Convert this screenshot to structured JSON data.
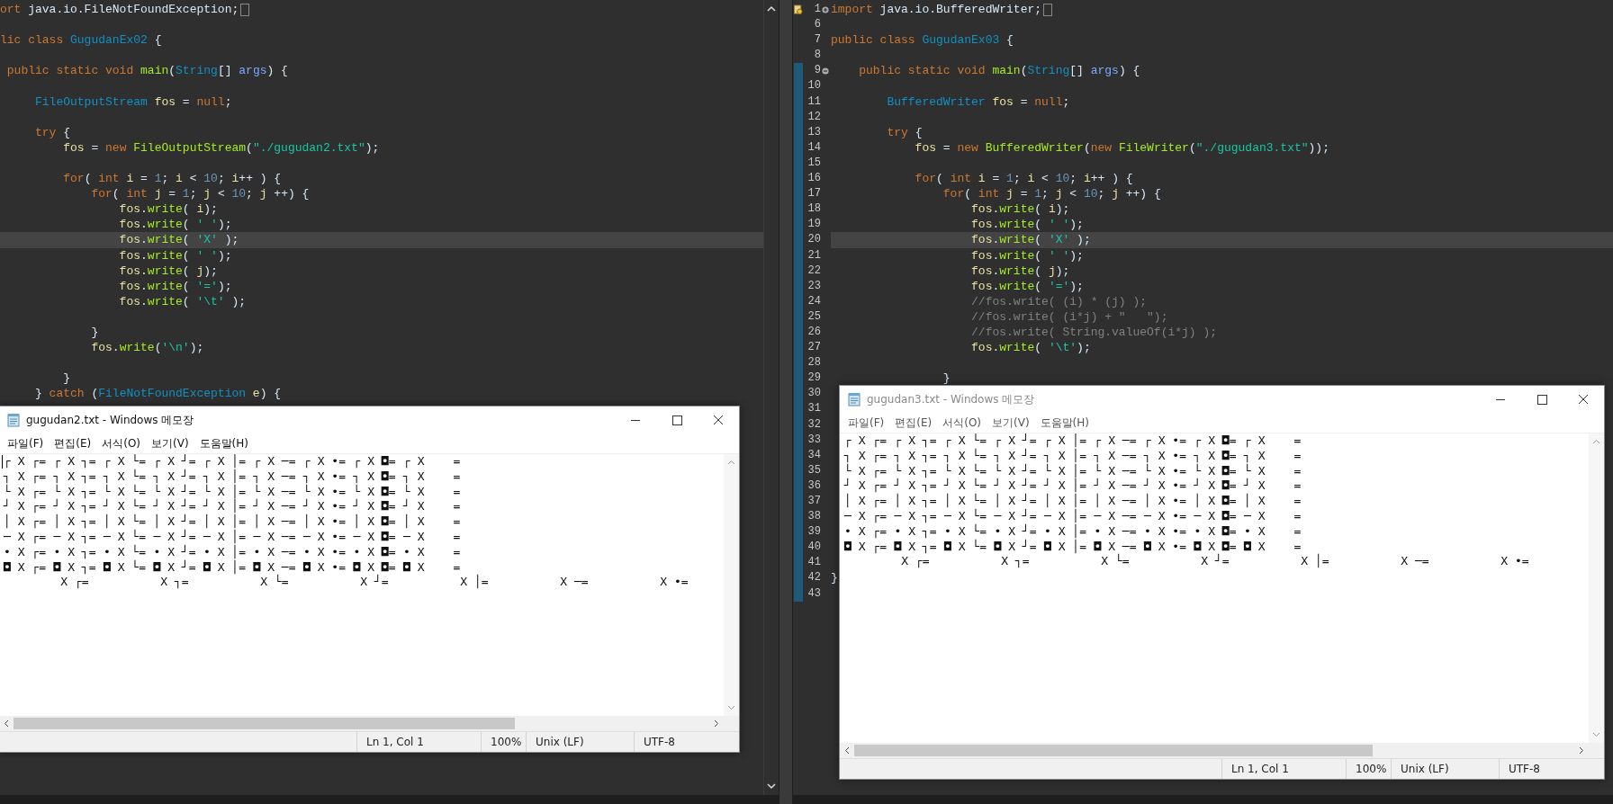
{
  "editors": [
    {
      "lines": [
        {
          "current": false,
          "folded": true,
          "tokens": [
            {
              "text": "ort",
              "kind": "keyword"
            },
            {
              "text": " java.io.FileNotFoundException;"
            }
          ]
        },
        {
          "current": false
        },
        {
          "current": false,
          "tokens": [
            {
              "text": "lic",
              "kind": "keyword"
            },
            {
              "text": " class",
              "kind": "keyword"
            },
            {
              "text": " GugudanEx02",
              "kind": "type"
            },
            {
              "text": " {"
            }
          ]
        },
        {
          "current": false
        },
        {
          "current": false,
          "tokens": [
            {
              "text": " public static void",
              "kind": "keyword"
            },
            {
              "text": " main",
              "kind": "method"
            },
            {
              "text": "("
            },
            {
              "text": "String",
              "kind": "type"
            },
            {
              "text": "[] "
            },
            {
              "text": "args",
              "kind": "param"
            },
            {
              "text": ") {"
            }
          ]
        },
        {
          "current": false
        },
        {
          "current": false,
          "tokens": [
            {
              "text": "     FileOutputStream",
              "kind": "type"
            },
            {
              "text": " fos",
              "kind": "variable"
            },
            {
              "text": " = "
            },
            {
              "text": "null",
              "kind": "keyword"
            },
            {
              "text": ";"
            }
          ]
        },
        {
          "current": false
        },
        {
          "current": false,
          "tokens": [
            {
              "text": "     try",
              "kind": "keyword"
            },
            {
              "text": " {"
            }
          ]
        },
        {
          "current": false,
          "tokens": [
            {
              "text": "         fos",
              "kind": "variable"
            },
            {
              "text": " = "
            },
            {
              "text": "new",
              "kind": "keyword"
            },
            {
              "text": " FileOutputStream",
              "kind": "method"
            },
            {
              "text": "("
            },
            {
              "text": "\"./gugudan2.txt\"",
              "kind": "string"
            },
            {
              "text": ");"
            }
          ]
        },
        {
          "current": false
        },
        {
          "current": false,
          "tokens": [
            {
              "text": "         for",
              "kind": "keyword"
            },
            {
              "text": "( "
            },
            {
              "text": "int",
              "kind": "keyword"
            },
            {
              "text": " i",
              "kind": "variable"
            },
            {
              "text": " = "
            },
            {
              "text": "1",
              "kind": "number"
            },
            {
              "text": "; "
            },
            {
              "text": "i",
              "kind": "variable"
            },
            {
              "text": " < "
            },
            {
              "text": "10",
              "kind": "number"
            },
            {
              "text": "; "
            },
            {
              "text": "i",
              "kind": "variable"
            },
            {
              "text": "++ ) {"
            }
          ]
        },
        {
          "current": false,
          "tokens": [
            {
              "text": "             for",
              "kind": "keyword"
            },
            {
              "text": "( "
            },
            {
              "text": "int",
              "kind": "keyword"
            },
            {
              "text": " j",
              "kind": "variable"
            },
            {
              "text": " = "
            },
            {
              "text": "1",
              "kind": "number"
            },
            {
              "text": "; "
            },
            {
              "text": "j",
              "kind": "variable"
            },
            {
              "text": " < "
            },
            {
              "text": "10",
              "kind": "number"
            },
            {
              "text": "; "
            },
            {
              "text": "j",
              "kind": "variable"
            },
            {
              "text": " ++) {"
            }
          ]
        },
        {
          "current": false,
          "tokens": [
            {
              "text": "                 fos",
              "kind": "variable"
            },
            {
              "text": "."
            },
            {
              "text": "write",
              "kind": "method"
            },
            {
              "text": "( "
            },
            {
              "text": "i",
              "kind": "variable"
            },
            {
              "text": ");"
            }
          ]
        },
        {
          "current": false,
          "tokens": [
            {
              "text": "                 fos",
              "kind": "variable"
            },
            {
              "text": "."
            },
            {
              "text": "write",
              "kind": "method"
            },
            {
              "text": "( "
            },
            {
              "text": "' '",
              "kind": "string"
            },
            {
              "text": ");"
            }
          ]
        },
        {
          "current": true,
          "tokens": [
            {
              "text": "                 fos",
              "kind": "variable"
            },
            {
              "text": "."
            },
            {
              "text": "write",
              "kind": "method"
            },
            {
              "text": "( "
            },
            {
              "text": "'X'",
              "kind": "string"
            },
            {
              "text": " );"
            }
          ]
        },
        {
          "current": false,
          "tokens": [
            {
              "text": "                 fos",
              "kind": "variable"
            },
            {
              "text": "."
            },
            {
              "text": "write",
              "kind": "method"
            },
            {
              "text": "( "
            },
            {
              "text": "' '",
              "kind": "string"
            },
            {
              "text": ");"
            }
          ]
        },
        {
          "current": false,
          "tokens": [
            {
              "text": "                 fos",
              "kind": "variable"
            },
            {
              "text": "."
            },
            {
              "text": "write",
              "kind": "method"
            },
            {
              "text": "( "
            },
            {
              "text": "j",
              "kind": "variable"
            },
            {
              "text": ");"
            }
          ]
        },
        {
          "current": false,
          "tokens": [
            {
              "text": "                 fos",
              "kind": "variable"
            },
            {
              "text": "."
            },
            {
              "text": "write",
              "kind": "method"
            },
            {
              "text": "( "
            },
            {
              "text": "'='",
              "kind": "string"
            },
            {
              "text": ");"
            }
          ]
        },
        {
          "current": false,
          "tokens": [
            {
              "text": "                 fos",
              "kind": "variable"
            },
            {
              "text": "."
            },
            {
              "text": "write",
              "kind": "method"
            },
            {
              "text": "( "
            },
            {
              "text": "'\\t'",
              "kind": "string"
            },
            {
              "text": " );"
            }
          ]
        },
        {
          "current": false
        },
        {
          "current": false,
          "tokens": [
            {
              "text": "             }"
            }
          ]
        },
        {
          "current": false,
          "tokens": [
            {
              "text": "             fos",
              "kind": "variable"
            },
            {
              "text": "."
            },
            {
              "text": "write",
              "kind": "method"
            },
            {
              "text": "("
            },
            {
              "text": "'\\n'",
              "kind": "string"
            },
            {
              "text": ");"
            }
          ]
        },
        {
          "current": false
        },
        {
          "current": false,
          "tokens": [
            {
              "text": "         }"
            }
          ]
        },
        {
          "current": false,
          "tokens": [
            {
              "text": "     } "
            },
            {
              "text": "catch",
              "kind": "keyword"
            },
            {
              "text": " ("
            },
            {
              "text": "FileNotFoundException",
              "kind": "type"
            },
            {
              "text": " e",
              "kind": "variable"
            },
            {
              "text": ") {"
            }
          ]
        }
      ]
    },
    {
      "lines": [
        {
          "number": "1",
          "current": false,
          "changed": false,
          "annotation": true,
          "folded": true,
          "tokens": [
            {
              "text": "import",
              "kind": "keyword"
            },
            {
              "text": " java.io.BufferedWriter;"
            }
          ]
        },
        {
          "number": "6",
          "current": false,
          "changed": false
        },
        {
          "number": "7",
          "current": false,
          "changed": false,
          "tokens": [
            {
              "text": "public class",
              "kind": "keyword"
            },
            {
              "text": " GugudanEx03",
              "kind": "type"
            },
            {
              "text": " {"
            }
          ]
        },
        {
          "number": "8",
          "current": false,
          "changed": false
        },
        {
          "number": "9",
          "current": false,
          "changed": true,
          "folded": false,
          "tokens": [
            {
              "text": "    public static void",
              "kind": "keyword"
            },
            {
              "text": " main",
              "kind": "method"
            },
            {
              "text": "("
            },
            {
              "text": "String",
              "kind": "type"
            },
            {
              "text": "[] "
            },
            {
              "text": "args",
              "kind": "param"
            },
            {
              "text": ") {"
            }
          ]
        },
        {
          "number": "10",
          "current": false,
          "changed": true
        },
        {
          "number": "11",
          "current": false,
          "changed": true,
          "tokens": [
            {
              "text": "        BufferedWriter",
              "kind": "type"
            },
            {
              "text": " fos",
              "kind": "variable"
            },
            {
              "text": " = "
            },
            {
              "text": "null",
              "kind": "keyword"
            },
            {
              "text": ";"
            }
          ]
        },
        {
          "number": "12",
          "current": false,
          "changed": true
        },
        {
          "number": "13",
          "current": false,
          "changed": true,
          "tokens": [
            {
              "text": "        try",
              "kind": "keyword"
            },
            {
              "text": " {"
            }
          ]
        },
        {
          "number": "14",
          "current": false,
          "changed": true,
          "tokens": [
            {
              "text": "            fos",
              "kind": "variable"
            },
            {
              "text": " = "
            },
            {
              "text": "new",
              "kind": "keyword"
            },
            {
              "text": " BufferedWriter",
              "kind": "method"
            },
            {
              "text": "("
            },
            {
              "text": "new",
              "kind": "keyword"
            },
            {
              "text": " FileWriter",
              "kind": "method"
            },
            {
              "text": "("
            },
            {
              "text": "\"./gugudan3.txt\"",
              "kind": "string"
            },
            {
              "text": "));"
            }
          ]
        },
        {
          "number": "15",
          "current": false,
          "changed": true
        },
        {
          "number": "16",
          "current": false,
          "changed": true,
          "tokens": [
            {
              "text": "            for",
              "kind": "keyword"
            },
            {
              "text": "( "
            },
            {
              "text": "int",
              "kind": "keyword"
            },
            {
              "text": " i",
              "kind": "variable"
            },
            {
              "text": " = "
            },
            {
              "text": "1",
              "kind": "number"
            },
            {
              "text": "; "
            },
            {
              "text": "i",
              "kind": "variable"
            },
            {
              "text": " < "
            },
            {
              "text": "10",
              "kind": "number"
            },
            {
              "text": "; "
            },
            {
              "text": "i",
              "kind": "variable"
            },
            {
              "text": "++ ) {"
            }
          ]
        },
        {
          "number": "17",
          "current": false,
          "changed": true,
          "tokens": [
            {
              "text": "                for",
              "kind": "keyword"
            },
            {
              "text": "( "
            },
            {
              "text": "int",
              "kind": "keyword"
            },
            {
              "text": " j",
              "kind": "variable"
            },
            {
              "text": " = "
            },
            {
              "text": "1",
              "kind": "number"
            },
            {
              "text": "; "
            },
            {
              "text": "j",
              "kind": "variable"
            },
            {
              "text": " < "
            },
            {
              "text": "10",
              "kind": "number"
            },
            {
              "text": "; "
            },
            {
              "text": "j",
              "kind": "variable"
            },
            {
              "text": " ++) {"
            }
          ]
        },
        {
          "number": "18",
          "current": false,
          "changed": true,
          "tokens": [
            {
              "text": "                    fos",
              "kind": "variable"
            },
            {
              "text": "."
            },
            {
              "text": "write",
              "kind": "method"
            },
            {
              "text": "( "
            },
            {
              "text": "i",
              "kind": "variable"
            },
            {
              "text": ");"
            }
          ]
        },
        {
          "number": "19",
          "current": false,
          "changed": true,
          "tokens": [
            {
              "text": "                    fos",
              "kind": "variable"
            },
            {
              "text": "."
            },
            {
              "text": "write",
              "kind": "method"
            },
            {
              "text": "( "
            },
            {
              "text": "' '",
              "kind": "string"
            },
            {
              "text": ");"
            }
          ]
        },
        {
          "number": "20",
          "current": true,
          "changed": true,
          "tokens": [
            {
              "text": "                    fos",
              "kind": "variable"
            },
            {
              "text": "."
            },
            {
              "text": "write",
              "kind": "method"
            },
            {
              "text": "( "
            },
            {
              "text": "'X'",
              "kind": "string"
            },
            {
              "text": " );"
            }
          ]
        },
        {
          "number": "21",
          "current": false,
          "changed": true,
          "tokens": [
            {
              "text": "                    fos",
              "kind": "variable"
            },
            {
              "text": "."
            },
            {
              "text": "write",
              "kind": "method"
            },
            {
              "text": "( "
            },
            {
              "text": "' '",
              "kind": "string"
            },
            {
              "text": ");"
            }
          ]
        },
        {
          "number": "22",
          "current": false,
          "changed": true,
          "tokens": [
            {
              "text": "                    fos",
              "kind": "variable"
            },
            {
              "text": "."
            },
            {
              "text": "write",
              "kind": "method"
            },
            {
              "text": "( "
            },
            {
              "text": "j",
              "kind": "variable"
            },
            {
              "text": ");"
            }
          ]
        },
        {
          "number": "23",
          "current": false,
          "changed": true,
          "tokens": [
            {
              "text": "                    fos",
              "kind": "variable"
            },
            {
              "text": "."
            },
            {
              "text": "write",
              "kind": "method"
            },
            {
              "text": "( "
            },
            {
              "text": "'='",
              "kind": "string"
            },
            {
              "text": ");"
            }
          ]
        },
        {
          "number": "24",
          "current": false,
          "changed": true,
          "tokens": [
            {
              "text": "                    //fos.write( (i) * (j) );",
              "kind": "comment"
            }
          ]
        },
        {
          "number": "25",
          "current": false,
          "changed": true,
          "tokens": [
            {
              "text": "                    //fos.write( (i*j) + \"   \");",
              "kind": "comment"
            }
          ]
        },
        {
          "number": "26",
          "current": false,
          "changed": true,
          "tokens": [
            {
              "text": "                    //fos.write( String.valueOf(i*j) );",
              "kind": "comment"
            }
          ]
        },
        {
          "number": "27",
          "current": false,
          "changed": true,
          "tokens": [
            {
              "text": "                    fos",
              "kind": "variable"
            },
            {
              "text": "."
            },
            {
              "text": "write",
              "kind": "method"
            },
            {
              "text": "( "
            },
            {
              "text": "'\\t'",
              "kind": "string"
            },
            {
              "text": ");"
            }
          ]
        },
        {
          "number": "28",
          "current": false,
          "changed": true
        },
        {
          "number": "29",
          "current": false,
          "changed": true,
          "tokens": [
            {
              "text": "                }"
            }
          ]
        },
        {
          "number": "30",
          "current": false,
          "changed": true
        },
        {
          "number": "31",
          "current": false,
          "changed": true
        },
        {
          "number": "32",
          "current": false,
          "changed": true
        },
        {
          "number": "33",
          "current": false,
          "changed": true
        },
        {
          "number": "34",
          "current": false,
          "changed": true
        },
        {
          "number": "35",
          "current": false,
          "changed": true
        },
        {
          "number": "36",
          "current": false,
          "changed": true
        },
        {
          "number": "37",
          "current": false,
          "changed": true
        },
        {
          "number": "38",
          "current": false,
          "changed": true
        },
        {
          "number": "39",
          "current": false,
          "changed": true
        },
        {
          "number": "40",
          "current": false,
          "changed": true
        },
        {
          "number": "41",
          "current": false,
          "changed": true
        },
        {
          "number": "42",
          "current": false,
          "changed": true,
          "tokens": [
            {
              "text": "}"
            }
          ]
        },
        {
          "number": "43",
          "current": false,
          "changed": true
        }
      ]
    }
  ],
  "notepads": [
    {
      "title": "gugudan2.txt - Windows 메모장",
      "active": true,
      "menu": [
        "파일(F)",
        "편집(E)",
        "서식(O)",
        "보기(V)",
        "도움말(H)"
      ],
      "lines": [
        "┌ X ┌=\t┌ X ┐=\t┌ X └=\t┌ X ┘=\t┌ X │=\t┌ X ─=\t┌ X •=\t┌ X ◘=\t┌ X \t=",
        "┐ X ┌=\t┐ X ┐=\t┐ X └=\t┐ X ┘=\t┐ X │=\t┐ X ─=\t┐ X •=\t┐ X ◘=\t┐ X \t=",
        "└ X ┌=\t└ X ┐=\t└ X └=\t└ X ┘=\t└ X │=\t└ X ─=\t└ X •=\t└ X ◘=\t└ X \t=",
        "┘ X ┌=\t┘ X ┐=\t┘ X └=\t┘ X ┘=\t┘ X │=\t┘ X ─=\t┘ X •=\t┘ X ◘=\t┘ X \t=",
        "│ X ┌=\t│ X ┐=\t│ X └=\t│ X ┘=\t│ X │=\t│ X ─=\t│ X •=\t│ X ◘=\t│ X \t=",
        "─ X ┌=\t─ X ┐=\t─ X └=\t─ X ┘=\t─ X │=\t─ X ─=\t─ X •=\t─ X ◘=\t─ X \t=",
        "• X ┌=\t• X ┐=\t• X └=\t• X ┘=\t• X │=\t• X ─=\t• X •=\t• X ◘=\t• X \t=",
        "◘ X ┌=\t◘ X ┐=\t◘ X └=\t◘ X ┘=\t◘ X │=\t◘ X ─=\t◘ X •=\t◘ X ◘=\t◘ X \t=",
        "\t X ┌=\t\t X ┐=\t\t X └=\t\t X ┘=\t\t X │=\t\t X ─=\t\t X •="
      ],
      "status": [
        "Ln 1, Col 1",
        "100%",
        "Unix (LF)",
        "UTF-8"
      ]
    },
    {
      "title": "gugudan3.txt - Windows 메모장",
      "active": false,
      "menu": [
        "파일(F)",
        "편집(E)",
        "서식(O)",
        "보기(V)",
        "도움말(H)"
      ],
      "lines": [
        "┌ X ┌=\t┌ X ┐=\t┌ X └=\t┌ X ┘=\t┌ X │=\t┌ X ─=\t┌ X •=\t┌ X ◘=\t┌ X \t=",
        "┐ X ┌=\t┐ X ┐=\t┐ X └=\t┐ X ┘=\t┐ X │=\t┐ X ─=\t┐ X •=\t┐ X ◘=\t┐ X \t=",
        "└ X ┌=\t└ X ┐=\t└ X └=\t└ X ┘=\t└ X │=\t└ X ─=\t└ X •=\t└ X ◘=\t└ X \t=",
        "┘ X ┌=\t┘ X ┐=\t┘ X └=\t┘ X ┘=\t┘ X │=\t┘ X ─=\t┘ X •=\t┘ X ◘=\t┘ X \t=",
        "│ X ┌=\t│ X ┐=\t│ X └=\t│ X ┘=\t│ X │=\t│ X ─=\t│ X •=\t│ X ◘=\t│ X \t=",
        "─ X ┌=\t─ X ┐=\t─ X └=\t─ X ┘=\t─ X │=\t─ X ─=\t─ X •=\t─ X ◘=\t─ X \t=",
        "• X ┌=\t• X ┐=\t• X └=\t• X ┘=\t• X │=\t• X ─=\t• X •=\t• X ◘=\t• X \t=",
        "◘ X ┌=\t◘ X ┐=\t◘ X └=\t◘ X ┘=\t◘ X │=\t◘ X ─=\t◘ X •=\t◘ X ◘=\t◘ X \t=",
        "\t X ┌=\t\t X ┐=\t\t X └=\t\t X ┘=\t\t X │=\t\t X ─=\t\t X •="
      ],
      "status": [
        "Ln 1, Col 1",
        "100%",
        "Unix (LF)",
        "UTF-8"
      ]
    }
  ]
}
